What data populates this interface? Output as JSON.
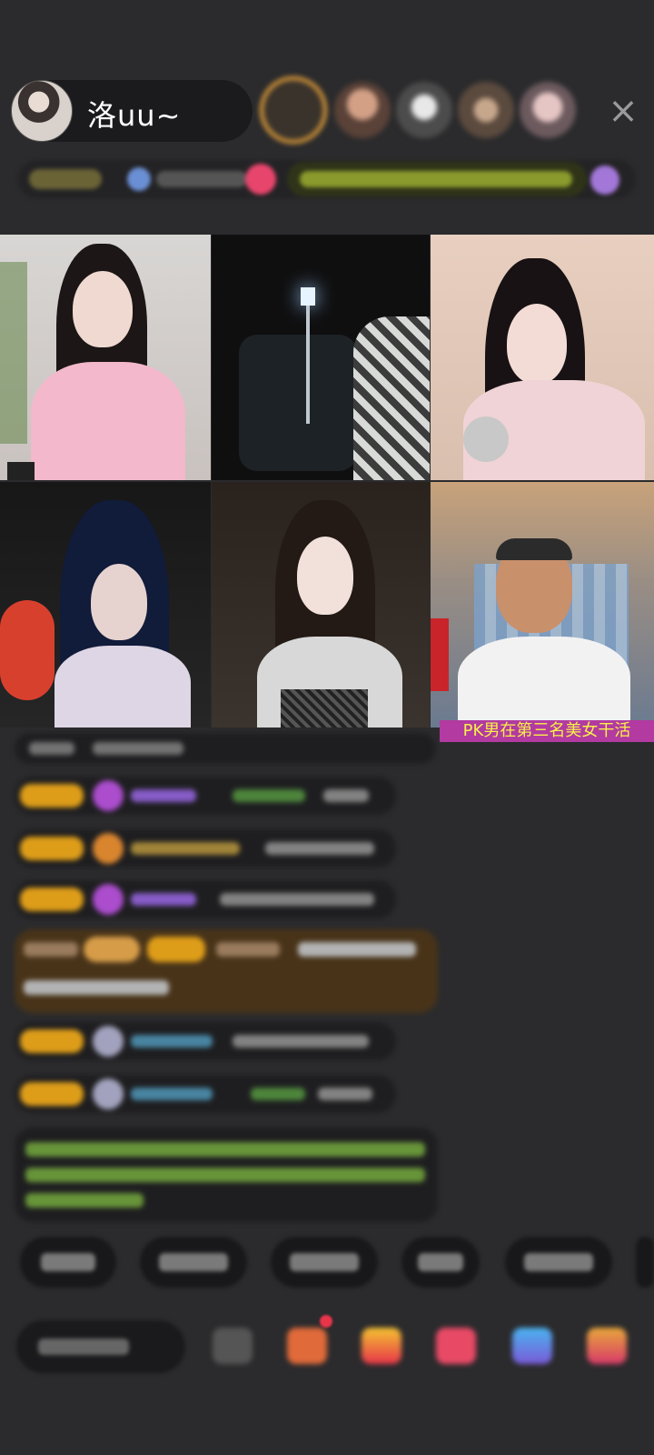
{
  "header": {
    "host_name": "洛uu~",
    "close_icon": "×"
  },
  "video_grid": {
    "pk_banner": "PK男在第三名美女干活"
  },
  "colors": {
    "background": "#2b2b2d",
    "pk_banner_bg": "#b23aa0",
    "pk_banner_text": "#f7f049",
    "badge": "#e8a418"
  }
}
